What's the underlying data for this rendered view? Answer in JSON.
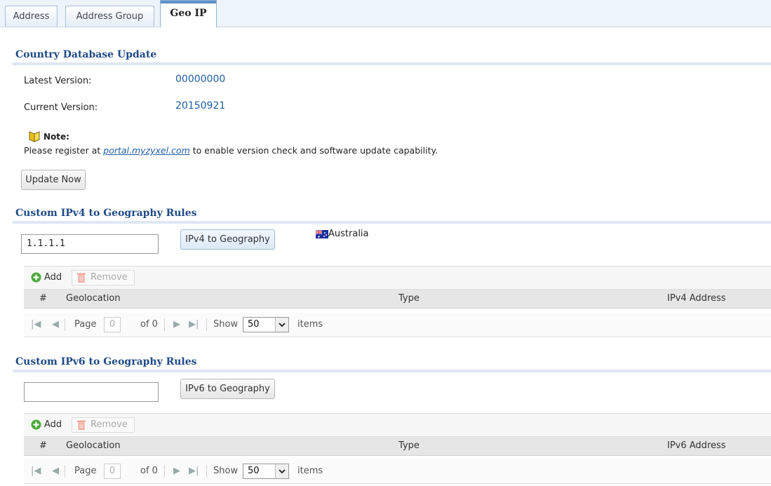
{
  "tabs": [
    {
      "label": "Address",
      "active": false
    },
    {
      "label": "Address Group",
      "active": false
    },
    {
      "label": "Geo IP",
      "active": true
    }
  ],
  "country_db": {
    "title": "Country Database Update",
    "latest_label": "Latest Version:",
    "latest_value": "00000000",
    "current_label": "Current Version:",
    "current_value": "20150921",
    "note_title": "Note:",
    "note_prefix": "Please register at ",
    "note_link": "portal.myzyxel.com",
    "note_suffix": " to enable version check and software update capability.",
    "update_button": "Update Now"
  },
  "ipv4": {
    "title": "Custom IPv4 to Geography Rules",
    "input_value": "1.1.1.1",
    "lookup_button": "IPv4 to Geography",
    "result_country": "Australia",
    "result_icon": "australia-flag-icon",
    "add_label": "Add",
    "remove_label": "Remove",
    "columns": [
      "#",
      "Geolocation",
      "Type",
      "IPv4 Address"
    ],
    "pager": {
      "page_label": "Page",
      "page_value": "0",
      "of_label": "of 0",
      "show_label": "Show",
      "show_value": "50",
      "items_label": "items"
    }
  },
  "ipv6": {
    "title": "Custom IPv6 to Geography Rules",
    "input_value": "",
    "lookup_button": "IPv6 to Geography",
    "add_label": "Add",
    "remove_label": "Remove",
    "columns": [
      "#",
      "Geolocation",
      "Type",
      "IPv6 Address"
    ],
    "pager": {
      "page_label": "Page",
      "page_value": "0",
      "of_label": "of 0",
      "show_label": "Show",
      "show_value": "50",
      "items_label": "items"
    }
  },
  "colors": {
    "accent": "#1f4a86",
    "link": "#1f5fa6",
    "tab_active_bar": "#5f91c8"
  }
}
